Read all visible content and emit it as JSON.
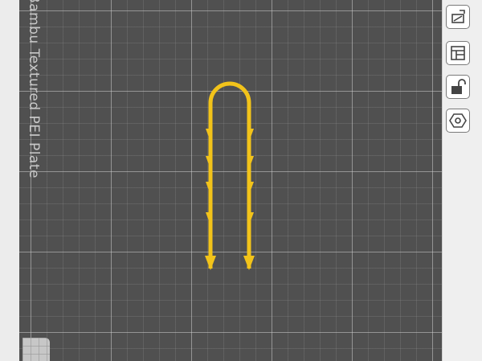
{
  "plate": {
    "label": "Bambu Textured PEI Plate"
  },
  "colors": {
    "plate_background": "#505050",
    "grid_lines": "#b5b5b5",
    "model_filament": "#f2c31a"
  },
  "toolbar": {
    "buttons": [
      {
        "name": "orient-icon"
      },
      {
        "name": "arrange-icon"
      },
      {
        "name": "lock-icon"
      },
      {
        "name": "plate-settings-icon"
      }
    ]
  }
}
